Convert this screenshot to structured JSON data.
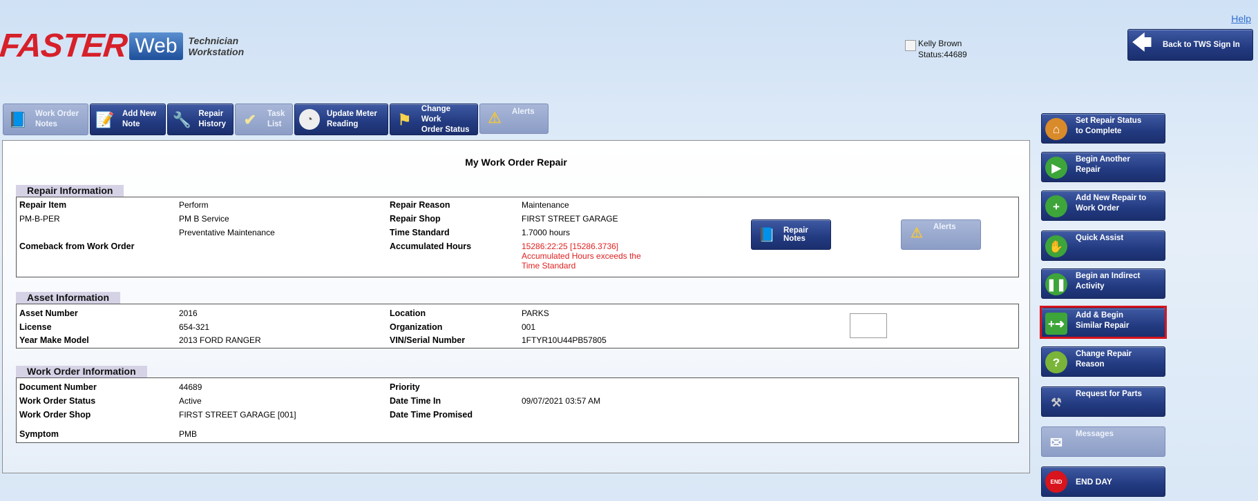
{
  "header": {
    "logo_main": "FASTER",
    "logo_web": "Web",
    "logo_sub_line1": "Technician",
    "logo_sub_line2": "Workstation",
    "help": "Help",
    "user_name": "Kelly Brown",
    "user_status": "Status:44689",
    "back_button": "Back to TWS Sign In"
  },
  "toolbar": [
    {
      "line1": "Work Order",
      "line2": "Notes",
      "icon": "notes-icon",
      "enabled": false
    },
    {
      "line1": "Add New",
      "line2": "Note",
      "icon": "add-note-icon",
      "enabled": true
    },
    {
      "line1": "Repair",
      "line2": "History",
      "icon": "wrench-icon",
      "enabled": true
    },
    {
      "line1": "Task",
      "line2": "List",
      "icon": "checkmark-icon",
      "enabled": false
    },
    {
      "line1": "Update Meter",
      "line2": "Reading",
      "icon": "gauge-icon",
      "enabled": true
    },
    {
      "line1": "Change Work",
      "line2": "Order Status",
      "icon": "flag-icon",
      "enabled": true
    },
    {
      "line1": "Alerts",
      "line2": "",
      "icon": "warning-icon",
      "enabled": false
    }
  ],
  "main": {
    "title": "My Work Order Repair",
    "repair": {
      "label": "Repair Information",
      "repair_item_label": "Repair Item",
      "repair_item_value": "Perform",
      "repair_code": "PM-B-PER",
      "repair_desc": "PM B Service",
      "repair_category": "Preventative Maintenance",
      "comeback_label": "Comeback from Work Order",
      "reason_label": "Repair Reason",
      "reason_value": "Maintenance",
      "shop_label": "Repair Shop",
      "shop_value": "FIRST STREET GARAGE",
      "time_std_label": "Time Standard",
      "time_std_value": "1.7000 hours",
      "acc_hours_label": "Accumulated Hours",
      "acc_hours_value": "15286:22:25 [15286.3736]",
      "acc_hours_warn1": "Accumulated Hours exceeds the",
      "acc_hours_warn2": "Time Standard",
      "notes_btn_line1": "Repair",
      "notes_btn_line2": "Notes",
      "alerts_btn": "Alerts"
    },
    "asset": {
      "label": "Asset Information",
      "asset_number_label": "Asset Number",
      "asset_number_value": "2016",
      "license_label": "License",
      "license_value": "654-321",
      "ymm_label": "Year Make Model",
      "ymm_value": "2013 FORD RANGER",
      "location_label": "Location",
      "location_value": "PARKS",
      "org_label": "Organization",
      "org_value": "001",
      "vin_label": "VIN/Serial Number",
      "vin_value": "1FTYR10U44PB57805"
    },
    "workorder": {
      "label": "Work Order Information",
      "doc_label": "Document Number",
      "doc_value": "44689",
      "status_label": "Work Order Status",
      "status_value": "Active",
      "shop_label": "Work Order Shop",
      "shop_value": "FIRST STREET GARAGE [001]",
      "symptom_label": "Symptom",
      "symptom_value": "PMB",
      "priority_label": "Priority",
      "priority_value": "",
      "time_in_label": "Date Time In",
      "time_in_value": "09/07/2021 03:57 AM",
      "promised_label": "Date Time Promised",
      "promised_value": ""
    }
  },
  "sidebar": [
    {
      "line1": "Set Repair Status",
      "line2": "to Complete",
      "icon": "person-house-icon",
      "enabled": true
    },
    {
      "line1": "Begin Another",
      "line2": "Repair",
      "icon": "play-icon",
      "enabled": true
    },
    {
      "line1": "Add New Repair to",
      "line2": "Work Order",
      "icon": "plus-circle-icon",
      "enabled": true
    },
    {
      "line1": "Quick Assist",
      "line2": "",
      "icon": "hand-icon",
      "enabled": true
    },
    {
      "line1": "Begin an Indirect",
      "line2": "Activity",
      "icon": "pause-icon",
      "enabled": true
    },
    {
      "line1": "Add & Begin",
      "line2": "Similar Repair",
      "icon": "plus-arrow-icon",
      "enabled": true
    },
    {
      "line1": "Change Repair",
      "line2": "Reason",
      "icon": "question-icon",
      "enabled": true
    },
    {
      "line1": "Request for Parts",
      "line2": "",
      "icon": "parts-icon",
      "enabled": true
    },
    {
      "line1": "Messages",
      "line2": "",
      "icon": "envelope-icon",
      "enabled": false
    },
    {
      "line1": "END DAY",
      "line2": "",
      "icon": "end-icon",
      "end_label": "END",
      "enabled": true
    }
  ]
}
